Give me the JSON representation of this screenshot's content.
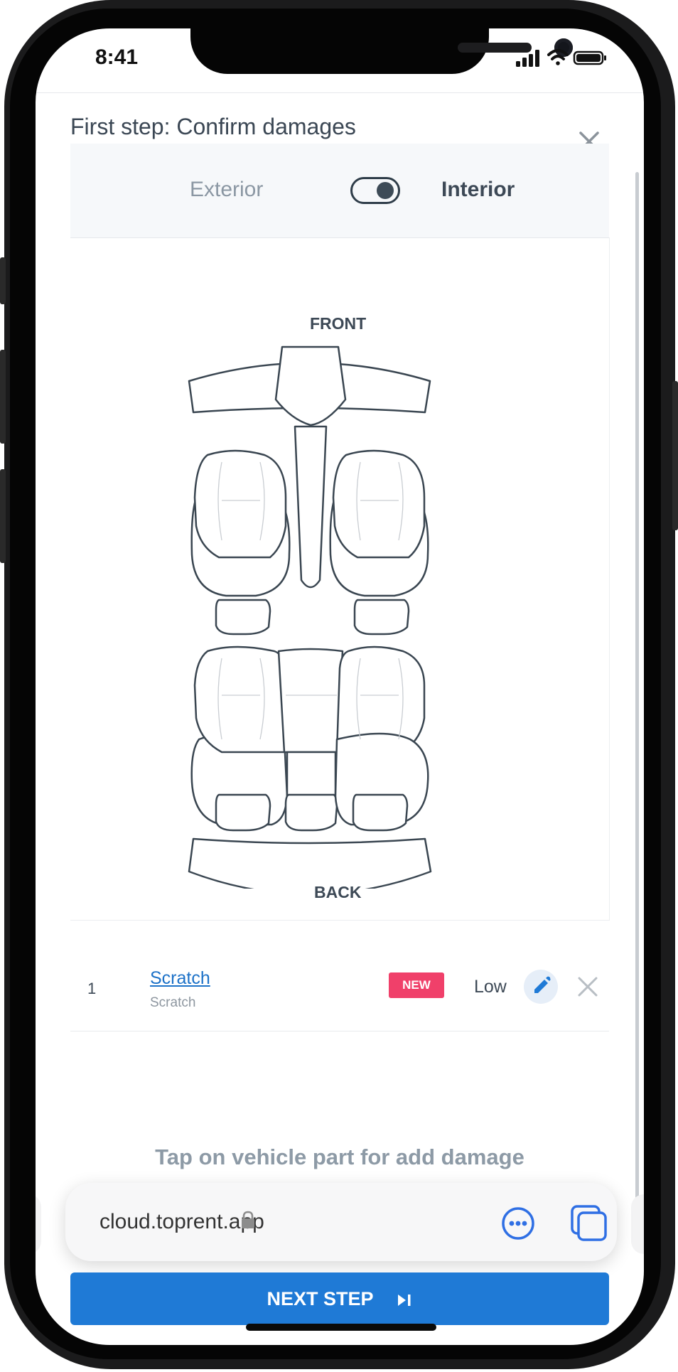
{
  "status_bar": {
    "time": "8:41"
  },
  "modal": {
    "title": "First step: Confirm damages"
  },
  "view_toggle": {
    "exterior_label": "Exterior",
    "interior_label": "Interior",
    "selected": "Interior"
  },
  "diagram": {
    "front_label": "FRONT",
    "back_label": "BACK"
  },
  "damages": [
    {
      "number": "1",
      "title": "Scratch",
      "subtitle": "Scratch",
      "badge": "NEW",
      "level": "Low"
    }
  ],
  "hint": "Tap on vehicle part for add damage",
  "browser": {
    "url": "cloud.toprent.app"
  },
  "footer": {
    "next_label": "NEXT STEP"
  },
  "colors": {
    "accent": "#1f7ad6",
    "badge": "#f0406a",
    "text": "#3d4956",
    "muted": "#8d9aa6"
  }
}
